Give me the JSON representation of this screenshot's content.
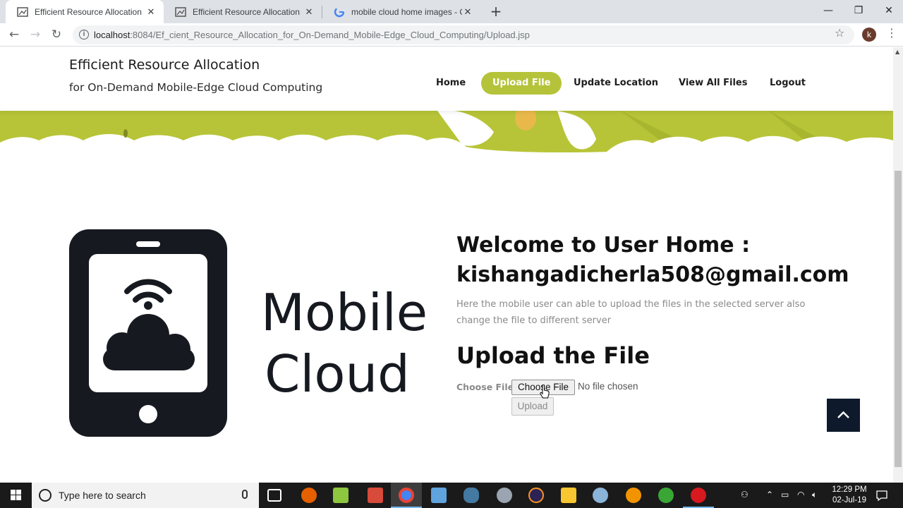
{
  "browser": {
    "tabs": [
      {
        "title": "Efficient Resource Allocation",
        "close": "✕"
      },
      {
        "title": "Efficient Resource Allocation",
        "close": "✕"
      },
      {
        "title": "mobile cloud home images - Goo",
        "close": "✕"
      }
    ],
    "new_tab": "+",
    "window_controls": {
      "minimize": "—",
      "maximize": "❐",
      "close": "✕"
    },
    "nav": {
      "back": "←",
      "forward": "→",
      "reload": "↻"
    },
    "url_host": "localhost",
    "url_path": ":8084/Ef_cient_Resource_Allocation_for_On-Demand_Mobile-Edge_Cloud_Computing/Upload.jsp",
    "profile_initial": "k",
    "star": "☆",
    "menu": "⋮"
  },
  "site": {
    "brand_title": "Efficient Resource Allocation",
    "brand_subtitle": "for On-Demand Mobile-Edge Cloud Computing",
    "nav": [
      "Home",
      "Upload File",
      "Update Location",
      "View All Files",
      "Logout"
    ],
    "active_nav": "Upload File",
    "accent_color": "#b5c33a"
  },
  "main": {
    "image_text_line1": "Mobile",
    "image_text_line2": "Cloud",
    "welcome_line1": "Welcome to User Home :",
    "welcome_line2": "kishangadicherla508@gmail.com",
    "description": "Here the mobile user can able to upload the files in the selected server also change the file to different server",
    "upload_heading": "Upload the File",
    "choose_label": "Choose File",
    "choose_button": "Choose File",
    "file_status": "No file chosen",
    "upload_button": "Upload"
  },
  "taskbar": {
    "search_placeholder": "Type here to search",
    "time": "12:29 PM",
    "date": "02-Jul-19"
  }
}
